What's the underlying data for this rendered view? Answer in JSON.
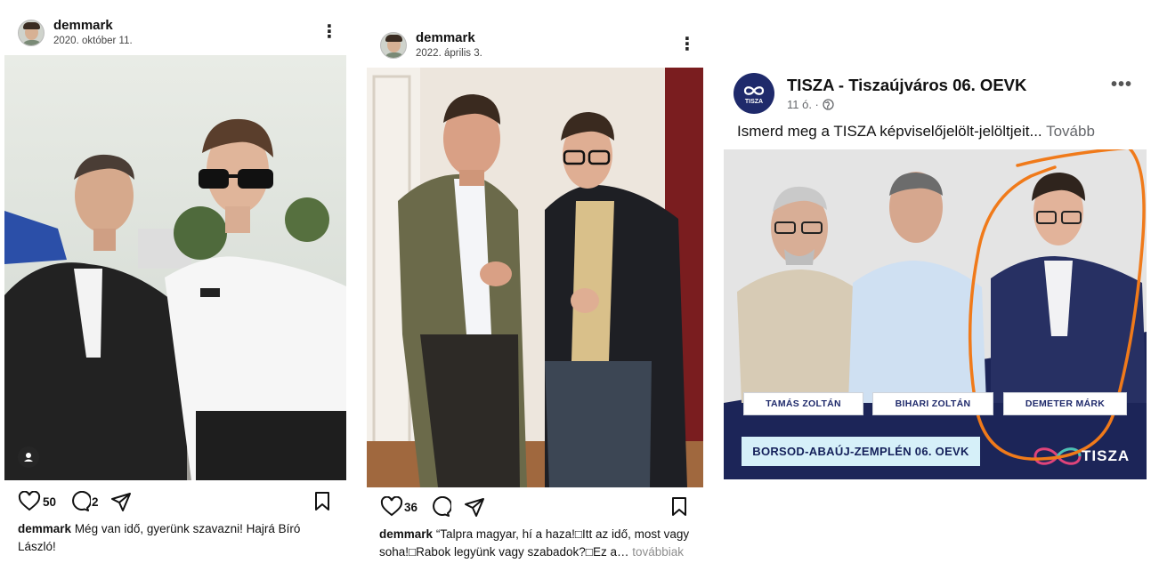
{
  "post1": {
    "username": "demmark",
    "date": "2020. október 11.",
    "likes": "50",
    "comments": "2",
    "caption_user": "demmark",
    "caption_text": "Még van idő, gyerünk szavazni! Hajrá Bíró",
    "caption_text_2": "László!"
  },
  "post2": {
    "username": "demmark",
    "date": "2022. április 3.",
    "likes": "36",
    "caption_user": "demmark",
    "caption_text": "“Talpra magyar, hí a haza!□Itt az idő, most vagy",
    "caption_text_2": "soha!□Rabok legyünk vagy szabadok?□Ez a…",
    "caption_more": "továbbiak"
  },
  "post3": {
    "page_name": "TISZA - Tiszaújváros 06. OEVK",
    "logo_text": "TISZA",
    "time": "11 ó. ·",
    "text": "Ismerd meg a TISZA képviselőjelölt-jelöltjeit...",
    "more": "Tovább",
    "candidates": [
      "TAMÁS ZOLTÁN",
      "BIHARI ZOLTÁN",
      "DEMETER MÁRK"
    ],
    "region": "BORSOD-ABAÚJ-ZEMPLÉN 06. OEVK",
    "brand": "TISZA"
  },
  "icons": [
    "heart-icon",
    "comment-icon",
    "share-icon",
    "bookmark-icon",
    "kebab-icon",
    "globe-icon",
    "user-tag-icon"
  ],
  "colors": {
    "highlight_orange": "#f07a1a",
    "tisza_navy": "#1f2a6b",
    "region_bg": "#d6f0f9",
    "muted": "#65676b"
  }
}
